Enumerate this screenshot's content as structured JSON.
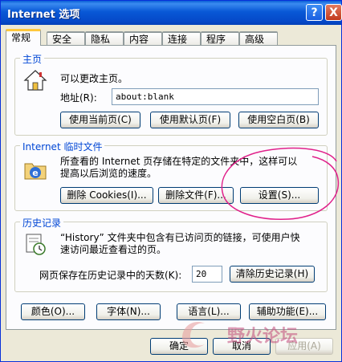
{
  "window": {
    "title": "Internet 选项",
    "help_label": "?",
    "close_label": "X"
  },
  "tabs": [
    "常规",
    "安全",
    "隐私",
    "内容",
    "连接",
    "程序",
    "高级"
  ],
  "home": {
    "group_label": "主页",
    "description": "可以更改主页。",
    "address_label": "地址(R):",
    "address_value": "about:blank",
    "btn_current": "使用当前页(C)",
    "btn_default": "使用默认页(F)",
    "btn_blank": "使用空白页(B)"
  },
  "temp": {
    "group_label": "Internet 临时文件",
    "line1": "所查看的 Internet 页存储在特定的文件夹中，这样可以",
    "line2": "提高以后浏览的速度。",
    "btn_cookies": "删除 Cookies(I)...",
    "btn_files": "删除文件(F)...",
    "btn_settings": "设置(S)..."
  },
  "history": {
    "group_label": "历史记录",
    "line1": "“History” 文件夹中包含有已访问页的链接，可使用户快",
    "line2": "速访问最近查看过的页。",
    "days_label": "网页保存在历史记录中的天数(K):",
    "days_value": "20",
    "btn_clear": "清除历史记录(H)"
  },
  "bottom_buttons": {
    "colors": "颜色(O)...",
    "fonts": "字体(N)...",
    "languages": "语言(L)...",
    "accessibility": "辅助功能(E)..."
  },
  "dialog_buttons": {
    "ok": "确定",
    "cancel": "取消",
    "apply": "应用(A)"
  },
  "watermark": {
    "text": "野火论坛",
    "color": "#cc9999"
  },
  "colors": {
    "accent": "#0046d5",
    "annotation": "#e0208a"
  }
}
